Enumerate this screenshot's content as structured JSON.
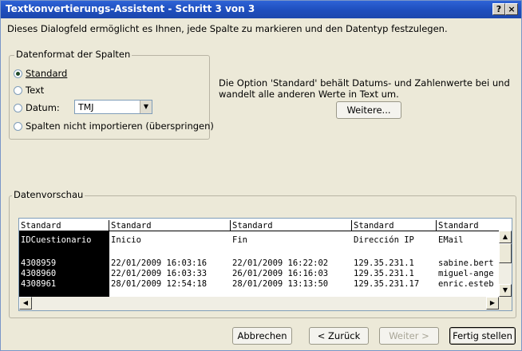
{
  "window": {
    "title": "Textkonvertierungs-Assistent - Schritt 3 von 3",
    "help_btn": "?",
    "close_btn": "×"
  },
  "description": "Dieses Dialogfeld ermöglicht es Ihnen, jede Spalte zu markieren und den Datentyp festzulegen.",
  "format_group": {
    "label": "Datenformat der Spalten",
    "options": [
      {
        "label": "Standard",
        "selected": true
      },
      {
        "label": "Text",
        "selected": false
      },
      {
        "label": "Datum:",
        "selected": false
      },
      {
        "label": "Spalten nicht importieren (überspringen)",
        "selected": false
      }
    ],
    "date_format_value": "TMJ"
  },
  "info_text": "Die Option 'Standard' behält Datums- und Zahlenwerte bei und wandelt alle anderen Werte in Text um.",
  "more_button": "Weitere...",
  "preview_group": {
    "label": "Datenvorschau",
    "headers": [
      "Standard",
      "Standard",
      "Standard",
      "Standard",
      "Standard"
    ],
    "rows": [
      [
        "IDCuestionario",
        "Inicio",
        "Fin",
        "Dirección IP",
        "EMail"
      ],
      [
        "",
        "",
        "",
        "",
        ""
      ],
      [
        "4308959",
        "22/01/2009 16:03:16",
        "22/01/2009 16:22:02",
        "129.35.231.1",
        "sabine.bert"
      ],
      [
        "4308960",
        "22/01/2009 16:03:33",
        "26/01/2009 16:16:03",
        "129.35.231.1",
        "miguel-ange"
      ],
      [
        "4308961",
        "28/01/2009 12:54:18",
        "28/01/2009 13:13:50",
        "129.35.231.17",
        "enric.esteb"
      ]
    ]
  },
  "buttons": {
    "cancel": "Abbrechen",
    "back": "< Zurück",
    "next": "Weiter >",
    "finish": "Fertig stellen"
  }
}
